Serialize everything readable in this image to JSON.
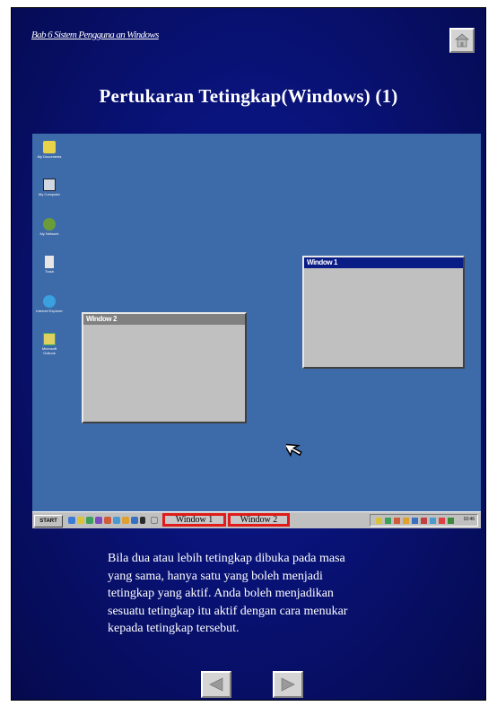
{
  "breadcrumb": "Bab 6 Sistem Pengguna an Windows",
  "title": "Pertukaran Tetingkap(Windows) (1)",
  "desktop": {
    "background": "#3d6aa8",
    "icons": [
      {
        "label": "My Documents",
        "icon": "folder-icon"
      },
      {
        "label": "My Computer",
        "icon": "computer-icon"
      },
      {
        "label": "My Network",
        "icon": "network-icon"
      },
      {
        "label": "Trash",
        "icon": "trash-icon"
      },
      {
        "label": "Internet Explorer",
        "icon": "ie-icon"
      },
      {
        "label": "Microsoft Outlook",
        "icon": "outlook-icon"
      }
    ],
    "window1_title": "Window 1",
    "window2_title": "Window 2",
    "active_title_color": "#0a1c86",
    "inactive_title_color": "#808080"
  },
  "taskbar": {
    "start_label": "START",
    "task1_label": "Window 1",
    "task2_label": "Window 2",
    "task_highlight_color": "#e11b1b",
    "clock": "10:46"
  },
  "body_lines": [
    "Bila dua atau lebih tetingkap dibuka pada masa",
    "yang sama, hanya satu yang boleh menjadi",
    "tetingkap yang aktif.  Anda boleh menjadikan",
    "sesuatu tetingkap itu aktif dengan cara menukar",
    "kepada tetingkap tersebut."
  ],
  "nav": {
    "prev_icon": "triangle-left-icon",
    "next_icon": "triangle-right-icon",
    "home_icon": "home-icon"
  }
}
